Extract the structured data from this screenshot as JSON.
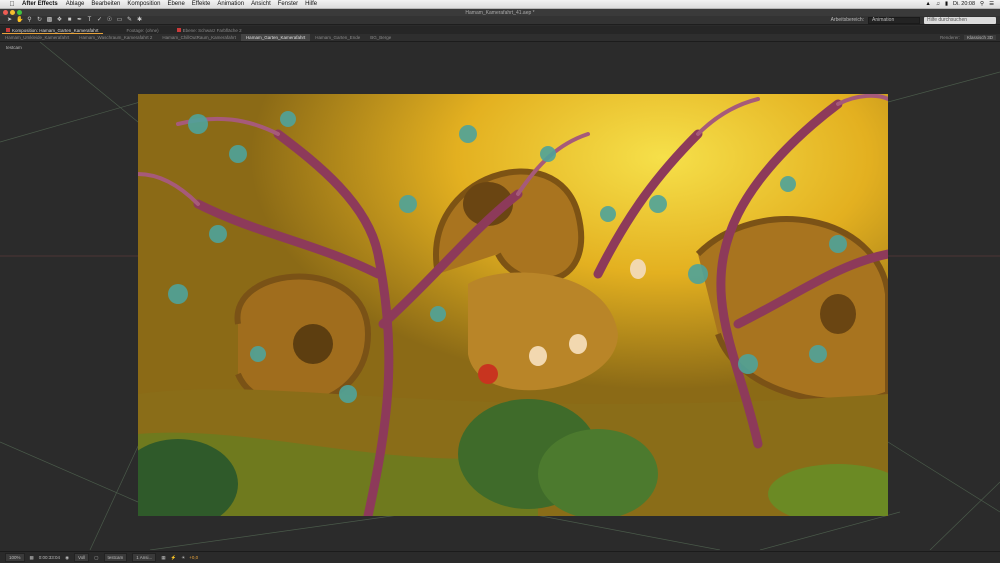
{
  "menubar": {
    "app_name": "After Effects",
    "items": [
      "Ablage",
      "Bearbeiten",
      "Komposition",
      "Ebene",
      "Effekte",
      "Animation",
      "Ansicht",
      "Fenster",
      "Hilfe"
    ],
    "clock": "Di. 20:08"
  },
  "window": {
    "title": "Hamam_Kamerafahrt_41.aep *"
  },
  "toolbar": {
    "workspace_label": "Arbeitsbereich:",
    "workspace_value": "Animation",
    "search_placeholder": "Hilfe durchsuchen"
  },
  "panels": {
    "composition_tab": "Komposition: Hamam_Garten_Kamerafahrt",
    "footage_tab": "Footage: (ohne)",
    "layer_tab": "Ebene: Schwarz Farbfläche 2"
  },
  "comp_tabs": [
    "Hamam_Umkleide_Kamerafahrt",
    "Hamam_Waschraum_Kamerafahrt 2",
    "Hamam_ChillOutRaum_Kamerafahrt",
    "Hamam_Garten_Kamerafahrt",
    "Hamam_Garten_Ende",
    "BG_Berge"
  ],
  "renderer": {
    "label": "Renderer:",
    "value": "Klassisch 3D"
  },
  "viewer": {
    "camera_label": "testcam"
  },
  "bottom": {
    "zoom": "100%",
    "timecode": "0:00:33:04",
    "resolution": "Voll",
    "camera": "testcam",
    "views": "1 Ansi...",
    "exposure": "+0,0"
  },
  "colors": {
    "accent": "#e8a33a",
    "sky": "#e9c21a"
  }
}
